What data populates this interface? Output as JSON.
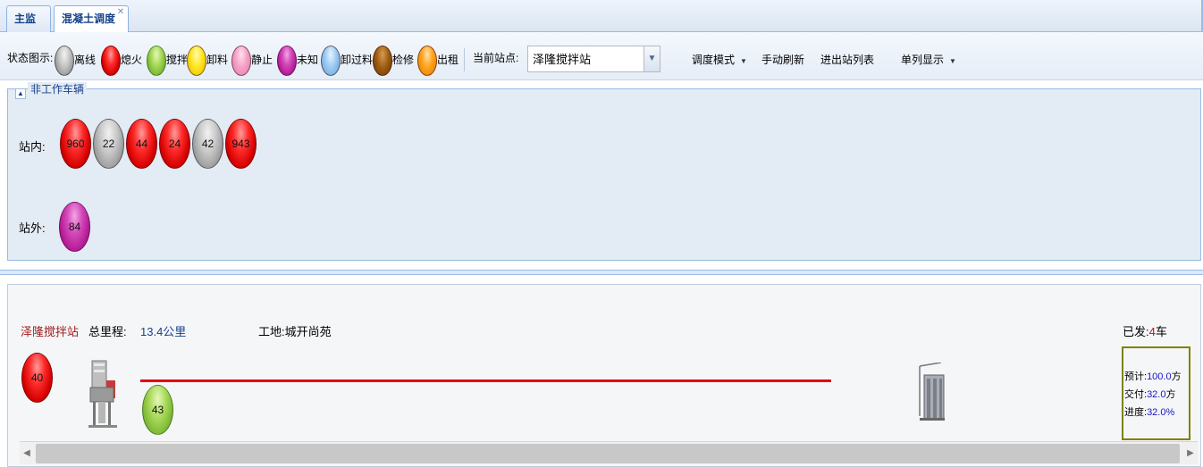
{
  "tabs": [
    {
      "label": "主监控",
      "active": false
    },
    {
      "label": "混凝土调度",
      "active": true,
      "close_icon": "close-icon"
    }
  ],
  "toolbar": {
    "legend_title": "状态图示:",
    "legend": [
      {
        "label": "离线",
        "color": "#9a9a9a",
        "class": "gray"
      },
      {
        "label": "熄火",
        "color": "#e60000",
        "class": "red"
      },
      {
        "label": "搅拌",
        "color": "#8cc63f",
        "class": "green"
      },
      {
        "label": "卸料",
        "color": "#ffe600",
        "class": "yellow"
      },
      {
        "label": "静止",
        "color": "#f5a3c8",
        "class": "pink"
      },
      {
        "label": "未知",
        "color": "#b0168f",
        "class": "magenta"
      },
      {
        "label": "卸过料",
        "color": "#9dcbf2",
        "class": "blue"
      },
      {
        "label": "检修",
        "color": "#8a4b00",
        "class": "brown"
      },
      {
        "label": "出租",
        "color": "#ffa21c",
        "class": "orange"
      }
    ],
    "station_label": "当前站点:",
    "station_value": "泽隆搅拌站",
    "dispatch_mode": "调度模式",
    "manual_refresh": "手动刷新",
    "entry_exit_list": "进出站列表",
    "single_column": "单列显示"
  },
  "idle_panel": {
    "legend": "非工作车辆",
    "inside_label": "站内:",
    "outside_label": "站外:",
    "inside_vehicles": [
      {
        "number": "960",
        "status": "red"
      },
      {
        "number": "22",
        "status": "gray"
      },
      {
        "number": "44",
        "status": "red"
      },
      {
        "number": "24",
        "status": "red"
      },
      {
        "number": "42",
        "status": "gray"
      },
      {
        "number": "943",
        "status": "red"
      }
    ],
    "outside_vehicles": [
      {
        "number": "84",
        "status": "magenta"
      }
    ]
  },
  "dispatch": {
    "station_name": "泽隆搅拌站",
    "total_distance_label": "总里程:",
    "total_distance_value": "13.4公里",
    "site": "工地:城开尚苑",
    "dispatched_prefix": "已发:",
    "dispatched_count": "4",
    "dispatched_suffix": "车",
    "station_vehicle": {
      "number": "40",
      "status": "red"
    },
    "route_vehicle": {
      "number": "43",
      "status": "green"
    },
    "planned_label": "预计:",
    "planned_value": "100.0",
    "planned_unit": "方",
    "delivered_label": "交付:",
    "delivered_value": "32.0",
    "delivered_unit": "方",
    "progress_label": "进度:",
    "progress_value": "32.0%",
    "route_color": "#e30000",
    "box_border_color": "#808000"
  }
}
